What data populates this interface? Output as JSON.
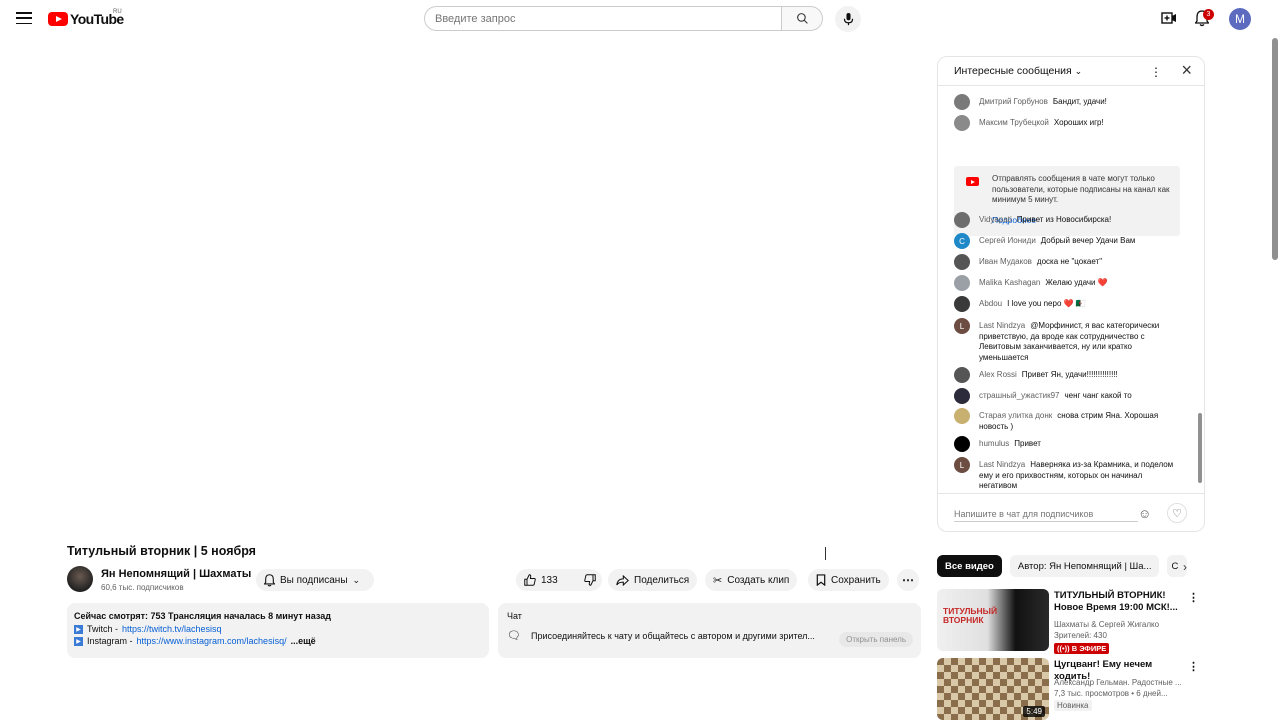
{
  "header": {
    "logo_text": "YouTube",
    "region": "RU",
    "search_placeholder": "Введите запрос",
    "notifications_count": "3",
    "avatar_letter": "М"
  },
  "video": {
    "title": "Титульный вторник | 5 ноября",
    "channel_name": "Ян Непомнящий | Шахматы",
    "subscribers": "60,6 тыс. подписчиков",
    "subscribed_label": "Вы подписаны",
    "likes": "133",
    "share_label": "Поделиться",
    "clip_label": "Создать клип",
    "save_label": "Сохранить"
  },
  "description": {
    "line1": "Сейчас смотрят: 753  Трансляция началась 8 минут назад",
    "twitch_label": "Twitch - ",
    "twitch_url": "https://twitch.tv/lachesisq",
    "instagram_label": "Instagram - ",
    "instagram_url": "https://www.instagram.com/lachesisq/",
    "more": "...ещё"
  },
  "chat_summary": {
    "title": "Чат",
    "text": "Присоединяйтесь к чату и общайтесь с автором и другими зрител...",
    "open_panel": "Открыть панель"
  },
  "chat": {
    "header": "Интересные сообщения",
    "notice_text": "Отправлять сообщения в чате могут только пользователи, которые подписаны на канал как минимум 5 минут.",
    "notice_link": "Подробнее",
    "input_placeholder": "Напишите в чат для подписчиков",
    "messages": [
      {
        "author": "Дмитрий Горбунов",
        "text": "Бандит, удачи!",
        "color": "#7a7a7a"
      },
      {
        "author": "Максим Трубецкой",
        "text": "Хороших игр!",
        "color": "#8a8a8a"
      },
      {
        "author": "Vidyapati",
        "text": "Привет из Новосибирска!",
        "color": "#6d6d6d"
      },
      {
        "author": "Сергей Иониди",
        "text": "Добрый вечер Удачи Вам",
        "color": "#1e88c8",
        "letter": "С"
      },
      {
        "author": "Иван Мудаков",
        "text": "доска не \"цокает\"",
        "color": "#555555"
      },
      {
        "author": "Malika Kashagan",
        "text": "Желаю удачи ❤️",
        "color": "#9aa0a6"
      },
      {
        "author": "Abdou",
        "text": "I love you nepo ❤️ 🇩🇿",
        "color": "#3a3a3a"
      },
      {
        "author": "Last Nindzya",
        "text": "@Морфинист, я вас категорически приветствую, да вроде как сотрудничество с Левитовым заканчивается, ну или кратко уменьшается",
        "color": "#6d4c41",
        "letter": "L"
      },
      {
        "author": "Alex Rossi",
        "text": "Привет Ян, удачи!!!!!!!!!!!!!!",
        "color": "#555555"
      },
      {
        "author": "страшный_ужастик97",
        "text": "ченг чанг какой то",
        "color": "#2b2b3b"
      },
      {
        "author": "Старая улитка донк",
        "text": "снова стрим Яна. Хорошая новость )",
        "color": "#c8b070"
      },
      {
        "author": "humulus",
        "text": "Привет",
        "color": "#000000"
      },
      {
        "author": "Last Nindzya",
        "text": "Наверняка из-за Крамника, и поделом ему и его прихвостням, которых он начинал негативом",
        "color": "#6d4c41",
        "letter": "L"
      }
    ]
  },
  "chips": [
    "Все видео",
    "Автор: Ян Непомнящий | Ша...",
    "С"
  ],
  "recommendations": [
    {
      "title": "ТИТУЛЬНЫЙ ВТОРНИК! Новое Время 19:00 МСК!...",
      "channel": "Шахматы & Сергей Жигалко",
      "stats": "Зрителей: 430",
      "badge": "((•)) В ЭФИРЕ",
      "thumb_text": "ТИТУЛЬНЫЙ ВТОРНИК"
    },
    {
      "title": "Цугцванг! Ему нечем ходить!",
      "channel": "Александр Гельман. Радостные ...",
      "stats": "7,3 тыс. просмотров • 6 дней...",
      "badge": "Новинка",
      "duration": "5:49"
    }
  ]
}
